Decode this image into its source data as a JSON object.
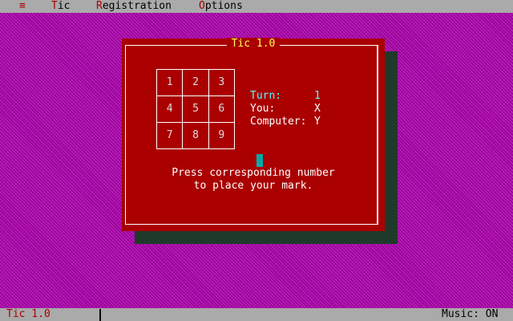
{
  "menu": {
    "system_icon": "≡",
    "items": [
      {
        "hot": "T",
        "rest": "ic"
      },
      {
        "hot": "R",
        "rest": "egistration"
      },
      {
        "hot": "O",
        "rest": "ptions"
      }
    ]
  },
  "dialog": {
    "title": "Tic 1.0",
    "board": [
      "1",
      "2",
      "3",
      "4",
      "5",
      "6",
      "7",
      "8",
      "9"
    ],
    "turn_label": "Turn:",
    "turn_value": "1",
    "you_label": "You:",
    "you_value": "X",
    "computer_label": "Computer:",
    "computer_value": "Y",
    "message_line1": "Press corresponding number",
    "message_line2": "to place your mark."
  },
  "status": {
    "app_name": "Tic 1.0",
    "music": "Music: ON"
  },
  "colors": {
    "desktop": "#a800a8",
    "dialog_bg": "#aa0000",
    "title": "#ffff55",
    "turn": "#55ffff",
    "cursor": "#00aaaa"
  }
}
